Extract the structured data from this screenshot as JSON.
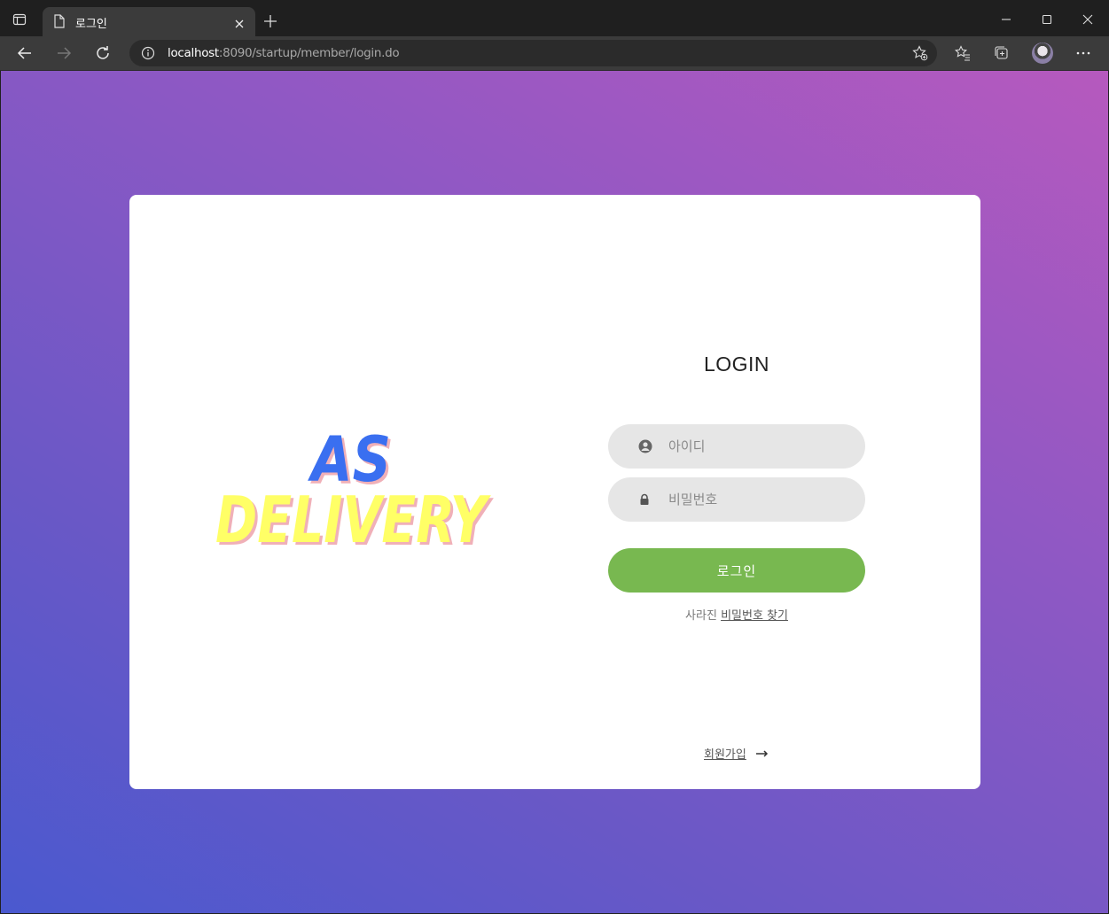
{
  "browser": {
    "tab_title": "로그인",
    "url_host": "localhost",
    "url_path": ":8090/startup/member/login.do"
  },
  "logo": {
    "line1": "AS",
    "line2": "DELIVERY",
    "line1_color": "#3a6ff0",
    "line2_color": "#ffff66",
    "shadow_color": "#f0b0b8"
  },
  "login": {
    "title": "LOGIN",
    "id_placeholder": "아이디",
    "pw_placeholder": "비밀번호",
    "submit_label": "로그인",
    "forgot_prefix": "사라진",
    "forgot_link": "비밀번호 찾기",
    "signup_link": "회원가입",
    "button_color": "#78b850"
  }
}
